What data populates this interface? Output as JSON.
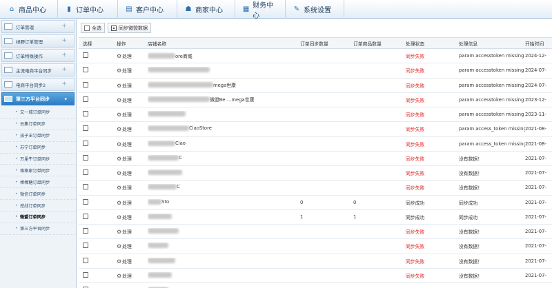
{
  "topnav": [
    {
      "label": "商品中心",
      "icon": "home-icon"
    },
    {
      "label": "订单中心",
      "icon": "bar-chart-icon"
    },
    {
      "label": "客户中心",
      "icon": "document-icon"
    },
    {
      "label": "商家中心",
      "icon": "user-icon"
    },
    {
      "label": "财务中心",
      "icon": "calendar-icon"
    },
    {
      "label": "系统设置",
      "icon": "wrench-icon"
    }
  ],
  "sidebar": {
    "groups": [
      "订单管理",
      "绿野订单管理",
      "订单特殊操作",
      "主流电商平台同步",
      "电商平台同步2"
    ],
    "active_group": "第三方平台同步",
    "items": [
      "又一城订单同步",
      "云集订单同步",
      "孩子王订单同步",
      "苏宁订单同步",
      "万里牛订单同步",
      "格格家订单同步",
      "棒棒糖订单同步",
      "微信订单同步",
      "挖战订单同步",
      "微盟订单同步",
      "第三方平台同步"
    ],
    "selected_item": "微盟订单同步"
  },
  "toolbar": {
    "select_all": "全选",
    "sync": "同步微盟数据"
  },
  "table": {
    "headers": [
      "选择",
      "操作",
      "店铺名称",
      "订单同步数量",
      "订单商品数量",
      "处理状态",
      "处理信息",
      "开始时间"
    ],
    "action_label": "处理",
    "rows": [
      {
        "store": "ore商城",
        "sync_count": "",
        "goods_count": "",
        "status": "同步失败",
        "info": "param accesstoken missing",
        "time": "2024-12-"
      },
      {
        "store": "",
        "sync_count": "",
        "goods_count": "",
        "status": "同步失败",
        "info": "param accesstoken missing",
        "time": "2024-07-"
      },
      {
        "store": "mega世康",
        "sync_count": "",
        "goods_count": "",
        "status": "同步失败",
        "info": "param accesstoken missing",
        "time": "2024-07-"
      },
      {
        "store": "微盟Be …mega世康",
        "sync_count": "",
        "goods_count": "",
        "status": "同步失败",
        "info": "param accesstoken missing",
        "time": "2023-12-"
      },
      {
        "store": "",
        "sync_count": "",
        "goods_count": "",
        "status": "同步失败",
        "info": "param accesstoken missing",
        "time": "2023-11-"
      },
      {
        "store": "CiaoStore",
        "sync_count": "",
        "goods_count": "",
        "status": "同步失败",
        "info": "param access_token missing p",
        "time": "2021-08-"
      },
      {
        "store": "Ciao",
        "sync_count": "",
        "goods_count": "",
        "status": "同步失败",
        "info": "param access_token missing p",
        "time": "2021-08-"
      },
      {
        "store": "C",
        "sync_count": "",
        "goods_count": "",
        "status": "同步失败",
        "info": "没有数据！",
        "time": "2021-07-"
      },
      {
        "store": "",
        "sync_count": "",
        "goods_count": "",
        "status": "同步失败",
        "info": "没有数据！",
        "time": "2021-07-"
      },
      {
        "store": "C",
        "sync_count": "",
        "goods_count": "",
        "status": "同步失败",
        "info": "没有数据！",
        "time": "2021-07-"
      },
      {
        "store": "Sto",
        "sync_count": "0",
        "goods_count": "0",
        "status": "同步成功",
        "info": "同步成功",
        "time": "2021-07-"
      },
      {
        "store": "",
        "sync_count": "1",
        "goods_count": "1",
        "status": "同步成功",
        "info": "同步成功",
        "time": "2021-07-"
      },
      {
        "store": "",
        "sync_count": "",
        "goods_count": "",
        "status": "同步失败",
        "info": "没有数据！",
        "time": "2021-07-"
      },
      {
        "store": "",
        "sync_count": "",
        "goods_count": "",
        "status": "同步失败",
        "info": "没有数据！",
        "time": "2021-07-"
      },
      {
        "store": "",
        "sync_count": "",
        "goods_count": "",
        "status": "同步失败",
        "info": "没有数据！",
        "time": "2021-07-"
      },
      {
        "store": "",
        "sync_count": "",
        "goods_count": "",
        "status": "同步失败",
        "info": "没有数据！",
        "time": "2021-07-"
      },
      {
        "store": "",
        "sync_count": "",
        "goods_count": "",
        "status": "同步失败",
        "info": "没有数据！",
        "time": "2021-07-"
      }
    ]
  }
}
